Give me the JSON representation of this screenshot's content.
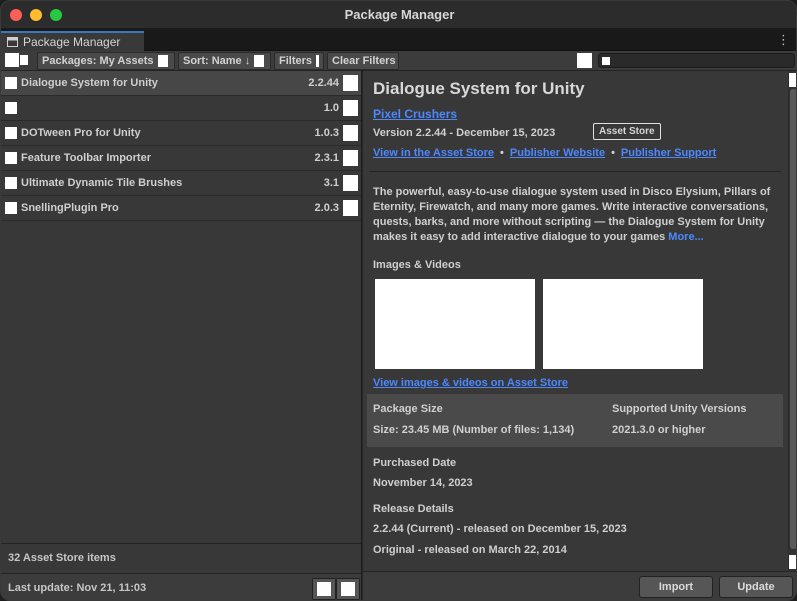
{
  "window": {
    "title": "Package Manager"
  },
  "tab": {
    "label": "Package Manager",
    "menu_icon": "kebab-menu-icon"
  },
  "toolbar": {
    "add_icon": "plus-icon",
    "packages_filter": "Packages: My Assets",
    "sort_label": "Sort: Name ↓",
    "filters_label": "Filters",
    "clear_filters_label": "Clear Filters",
    "search_value": "",
    "search_placeholder": ""
  },
  "packages": [
    {
      "name": "Dialogue System for Unity",
      "version": "2.2.44"
    },
    {
      "name": "",
      "version": "1.0"
    },
    {
      "name": "DOTween Pro for Unity",
      "version": "1.0.3"
    },
    {
      "name": "Feature Toolbar Importer",
      "version": "2.3.1"
    },
    {
      "name": "Ultimate Dynamic Tile Brushes",
      "version": "3.1"
    },
    {
      "name": "SnellingPlugin Pro",
      "version": "2.0.3"
    }
  ],
  "left_status": {
    "count_text": "32 Asset Store items"
  },
  "left_footer": {
    "updated_text": "Last update: Nov 21, 11:03"
  },
  "details": {
    "title": "Dialogue System for Unity",
    "author": "Pixel Crushers",
    "version_line": "Version 2.2.44 - December 15, 2023",
    "tag": "Asset Store",
    "links": [
      "View in the Asset Store",
      "Publisher Website",
      "Publisher Support"
    ],
    "description": "The powerful, easy-to-use dialogue system used in Disco Elysium, Pillars of Eternity, Firewatch, and many more games. Write interactive conversations, quests, barks, and more without scripting — the Dialogue System for Unity makes it easy to add interactive dialogue to your games",
    "more_label": "More...",
    "images_heading": "Images & Videos",
    "images_link": "View images & videos on Asset Store",
    "info": {
      "size_label": "Package Size",
      "size_value": "Size: 23.45 MB (Number of files: 1,134)",
      "unity_label": "Supported Unity Versions",
      "unity_value": "2021.3.0 or higher"
    },
    "purchased_heading": "Purchased Date",
    "purchased_value": "November 14, 2023",
    "release_heading": "Release Details",
    "release_current": "2.2.44 (Current) - released on December 15, 2023",
    "release_original": "Original - released on March 22, 2014"
  },
  "footer": {
    "import_label": "Import",
    "update_label": "Update"
  }
}
